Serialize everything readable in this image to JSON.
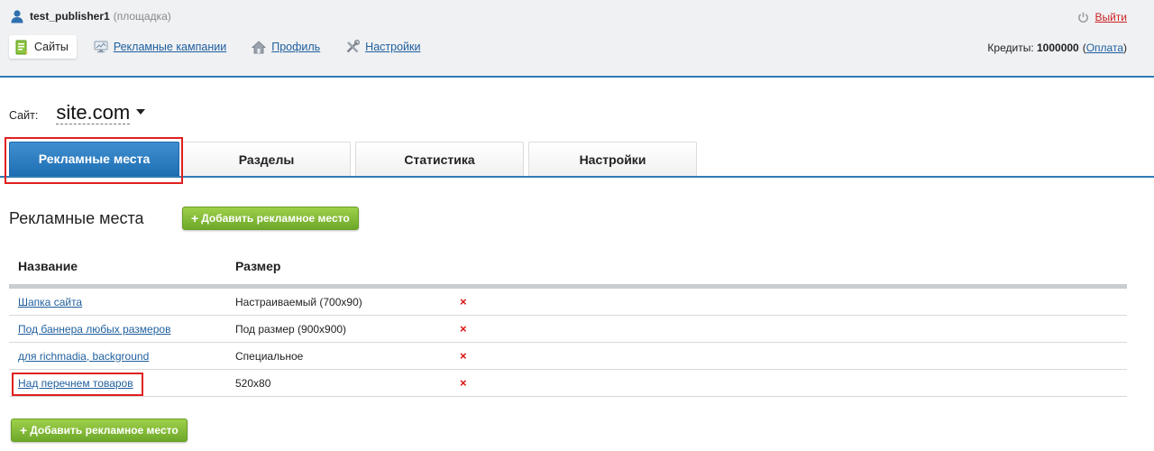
{
  "header": {
    "username": "test_publisher1",
    "role": "(площадка)",
    "logout": "Выйти",
    "credits_label": "Кредиты:",
    "credits_value": "1000000",
    "credits_paren_open": "(",
    "credits_link": "Оплата",
    "credits_paren_close": ")"
  },
  "nav": [
    {
      "label": "Сайты",
      "icon": "sites-icon",
      "active": true
    },
    {
      "label": "Рекламные кампании",
      "icon": "campaign-icon",
      "active": false
    },
    {
      "label": "Профиль",
      "icon": "home-icon",
      "active": false
    },
    {
      "label": "Настройки",
      "icon": "tools-icon",
      "active": false
    }
  ],
  "site": {
    "label": "Сайт:",
    "selected": "site.com"
  },
  "tabs": [
    {
      "label": "Рекламные места",
      "active": true
    },
    {
      "label": "Разделы",
      "active": false
    },
    {
      "label": "Статистика",
      "active": false
    },
    {
      "label": "Настройки",
      "active": false
    }
  ],
  "section": {
    "title": "Рекламные места",
    "add_button": "Добавить рекламное место"
  },
  "table": {
    "columns": [
      "Название",
      "Размер"
    ],
    "rows": [
      {
        "name": "Шапка сайта",
        "size": "Настраиваемый (700x90)"
      },
      {
        "name": "Под баннера любых размеров",
        "size": "Под размер (900x900)"
      },
      {
        "name": "для richmadia, background",
        "size": "Специальное"
      },
      {
        "name": "Над перечнем товаров",
        "size": "520x80"
      }
    ],
    "delete_symbol": "×"
  },
  "colors": {
    "accent_blue": "#2f7bb3",
    "link_blue": "#1f5f9e",
    "button_green": "#7db832",
    "delete_red": "#dd1111",
    "highlight_red": "#e02020"
  }
}
